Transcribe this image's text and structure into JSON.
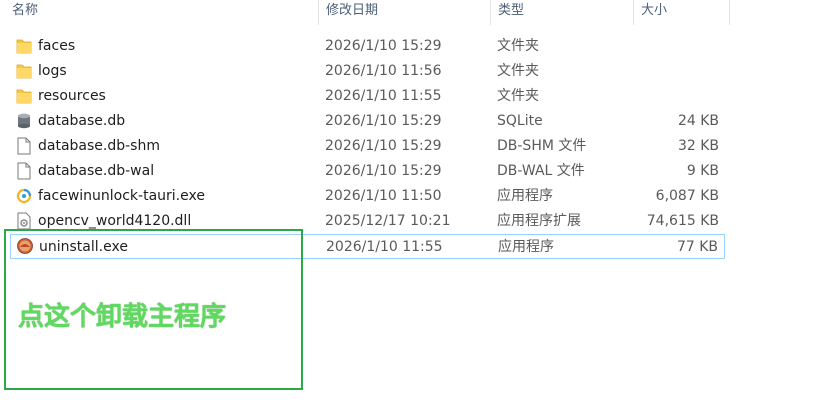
{
  "columns": {
    "name": "名称",
    "date": "修改日期",
    "type": "类型",
    "size": "大小"
  },
  "files": [
    {
      "name": "faces",
      "date": "2026/1/10 15:29",
      "type": "文件夹",
      "size": "",
      "icon": "folder-icon"
    },
    {
      "name": "logs",
      "date": "2026/1/10 11:56",
      "type": "文件夹",
      "size": "",
      "icon": "folder-icon"
    },
    {
      "name": "resources",
      "date": "2026/1/10 11:55",
      "type": "文件夹",
      "size": "",
      "icon": "folder-icon"
    },
    {
      "name": "database.db",
      "date": "2026/1/10 15:29",
      "type": "SQLite",
      "size": "24 KB",
      "icon": "database-icon"
    },
    {
      "name": "database.db-shm",
      "date": "2026/1/10 15:29",
      "type": "DB-SHM 文件",
      "size": "32 KB",
      "icon": "file-icon"
    },
    {
      "name": "database.db-wal",
      "date": "2026/1/10 15:29",
      "type": "DB-WAL 文件",
      "size": "9 KB",
      "icon": "file-icon"
    },
    {
      "name": "facewinunlock-tauri.exe",
      "date": "2026/1/10 11:50",
      "type": "应用程序",
      "size": "6,087 KB",
      "icon": "app-icon"
    },
    {
      "name": "opencv_world4120.dll",
      "date": "2025/12/17 10:21",
      "type": "应用程序扩展",
      "size": "74,615 KB",
      "icon": "dll-icon"
    },
    {
      "name": "uninstall.exe",
      "date": "2026/1/10 11:55",
      "type": "应用程序",
      "size": "77 KB",
      "icon": "installer-icon"
    }
  ],
  "annotation": {
    "text": "点这个卸载主程序",
    "color": "#5fd95f",
    "box_color": "#2aa84a"
  },
  "colors": {
    "selection_border": "#99d1ff",
    "folder": "#f6c847",
    "header_text": "#4c607a"
  }
}
